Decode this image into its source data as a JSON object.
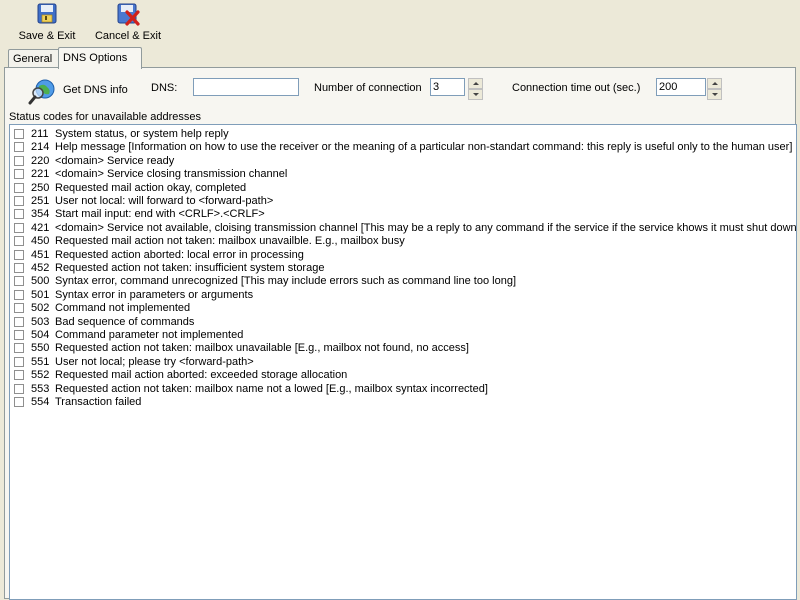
{
  "toolbar": {
    "save_label": "Save & Exit",
    "cancel_label": "Cancel & Exit"
  },
  "tabs": [
    {
      "label": "General",
      "active": false
    },
    {
      "label": "DNS Options",
      "active": true
    }
  ],
  "dns_options": {
    "get_dns_label": "Get DNS info",
    "dns_label": "DNS:",
    "dns_value": "",
    "connections_label": "Number of connection",
    "connections_value": "3",
    "timeout_label": "Connection time out (sec.)",
    "timeout_value": "200"
  },
  "status_list": {
    "caption": "Status codes for unavailable addresses",
    "items": [
      {
        "code": "211",
        "text": "System status, or system help reply",
        "checked": false
      },
      {
        "code": "214",
        "text": "Help message [Information on how to use the receiver or the meaning of a particular non-standart command: this reply is useful only to the human user]",
        "checked": false
      },
      {
        "code": "220",
        "text": "<domain> Service ready",
        "checked": false
      },
      {
        "code": "221",
        "text": "<domain> Service closing transmission channel",
        "checked": false
      },
      {
        "code": "250",
        "text": "Requested mail action okay, completed",
        "checked": false
      },
      {
        "code": "251",
        "text": "User not local: will forward to <forward-path>",
        "checked": false
      },
      {
        "code": "354",
        "text": "Start mail input: end with <CRLF>.<CRLF>",
        "checked": false
      },
      {
        "code": "421",
        "text": "<domain> Service not available, cloising transmission channel [This may be a reply to any command if the service if the service khows it must shut down]",
        "checked": false
      },
      {
        "code": "450",
        "text": "Requested mail action not taken: mailbox unavailble. E.g., mailbox busy",
        "checked": false
      },
      {
        "code": "451",
        "text": "Requested action aborted: local error in processing",
        "checked": false
      },
      {
        "code": "452",
        "text": "Requested action not taken: insufficient system storage",
        "checked": false
      },
      {
        "code": "500",
        "text": "Syntax error, command unrecognized [This may include errors such as command line too long]",
        "checked": false
      },
      {
        "code": "501",
        "text": "Syntax error in parameters or arguments",
        "checked": false
      },
      {
        "code": "502",
        "text": "Command not implemented",
        "checked": false
      },
      {
        "code": "503",
        "text": "Bad sequence of commands",
        "checked": false
      },
      {
        "code": "504",
        "text": "Command parameter not implemented",
        "checked": false
      },
      {
        "code": "550",
        "text": "Requested action not taken: mailbox unavailable [E.g., mailbox not found, no access]",
        "checked": false
      },
      {
        "code": "551",
        "text": "User not local; please try <forward-path>",
        "checked": false
      },
      {
        "code": "552",
        "text": "Requested mail action aborted: exceeded storage allocation",
        "checked": false
      },
      {
        "code": "553",
        "text": "Requested action not taken: mailbox name not a lowed [E.g., mailbox syntax incorrected]",
        "checked": false
      },
      {
        "code": "554",
        "text": "Transaction failed",
        "checked": false
      }
    ]
  },
  "icons": {
    "save": "floppy-disk-save-icon",
    "cancel": "floppy-disk-cancel-icon",
    "get_dns": "globe-magnifier-icon"
  },
  "colors": {
    "window_bg": "#ece9d8",
    "panel_bg": "#f7f6f1",
    "border": "#919b9c",
    "input_border": "#7f9db9"
  }
}
